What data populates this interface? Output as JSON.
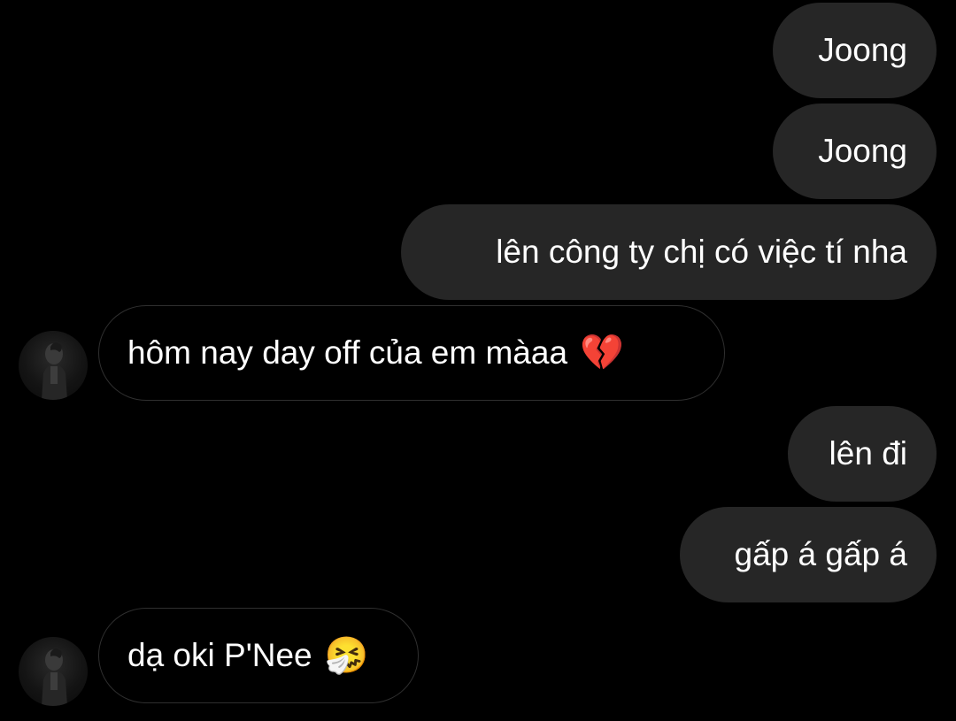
{
  "messages": [
    {
      "side": "sent",
      "text": "Joong"
    },
    {
      "side": "sent",
      "text": "Joong"
    },
    {
      "side": "sent",
      "text": "lên công ty chị có việc tí nha"
    },
    {
      "side": "received",
      "text": "hôm nay day off của em màaa",
      "emoji": "💔"
    },
    {
      "side": "sent",
      "text": "lên đi"
    },
    {
      "side": "sent",
      "text": "gấp á gấp á"
    },
    {
      "side": "received",
      "text": "dạ oki P'Nee",
      "emoji": "🤧"
    }
  ],
  "colors": {
    "background": "#000000",
    "sent_bubble": "#262626",
    "received_bubble_border": "#2f2f2f",
    "text": "#ffffff"
  },
  "icons": {
    "avatar": "contact-avatar-photo"
  }
}
